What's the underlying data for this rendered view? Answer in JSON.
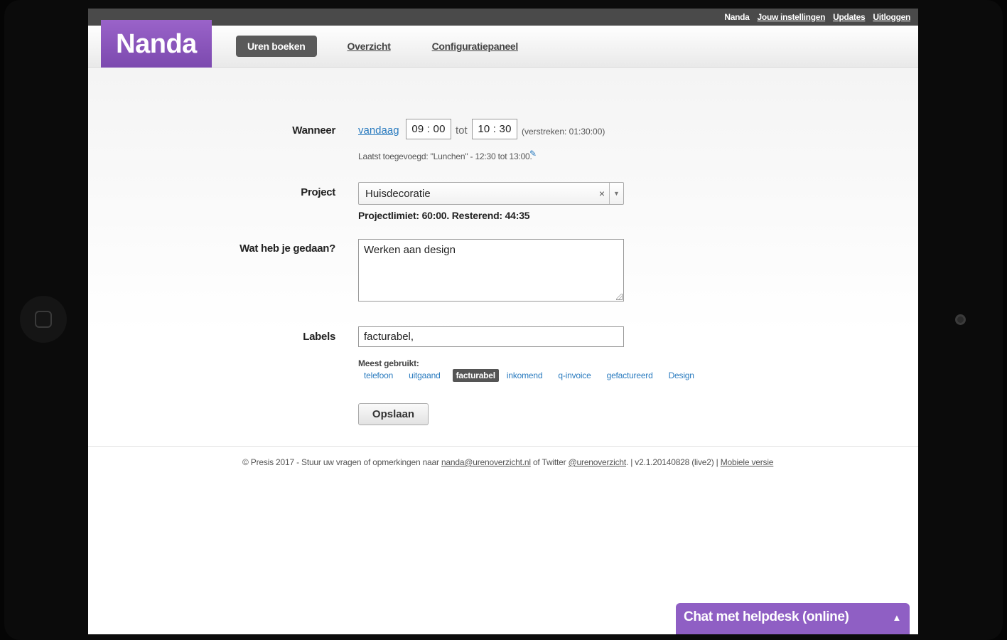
{
  "topbar": {
    "user": "Nanda",
    "settings": "Jouw instellingen",
    "updates": "Updates",
    "logout": "Uitloggen"
  },
  "header": {
    "logo": "Nanda",
    "tabs": [
      "Uren boeken",
      "Overzicht",
      "Configuratiepaneel"
    ],
    "active_tab": "Uren boeken"
  },
  "form": {
    "when_label": "Wanneer",
    "today_link": "vandaag",
    "start_time": "09 : 00",
    "to_word": "tot",
    "end_time": "10 : 30",
    "elapsed": "(verstreken: 01:30:00)",
    "last_added": "Laatst toegevoegd: \"Lunchen\" - 12:30 tot 13:00.",
    "project_label": "Project",
    "project_value": "Huisdecoratie",
    "project_limit": "Projectlimiet: 60:00. Resterend: 44:35",
    "done_label": "Wat heb je gedaan?",
    "done_value": "Werken aan design",
    "labels_label": "Labels",
    "labels_value": "facturabel,",
    "most_used": "Meest gebruikt:",
    "tags": [
      "telefoon",
      "uitgaand",
      "facturabel",
      "inkomend",
      "q-invoice",
      "gefactureerd",
      "Design"
    ],
    "active_tag": "facturabel",
    "save_button": "Opslaan"
  },
  "footer": {
    "prefix": "© Presis 2017 - Stuur uw vragen of opmerkingen naar",
    "email": "nanda@urenoverzicht.nl",
    "mid": "of Twitter",
    "twitter": "@urenoverzicht",
    "version": ".   |  v2.1.20140828 (live2)  |",
    "mobile": "Mobiele versie"
  },
  "chat": {
    "label": "Chat met helpdesk (online)"
  },
  "icons": {
    "clear": "×",
    "dropdown": "▼",
    "pencil": "✎",
    "chevron_up": "︿"
  },
  "colors": {
    "brand": "#8f5fc4",
    "link": "#2a7bbf",
    "topbar": "#4a4a4a"
  }
}
